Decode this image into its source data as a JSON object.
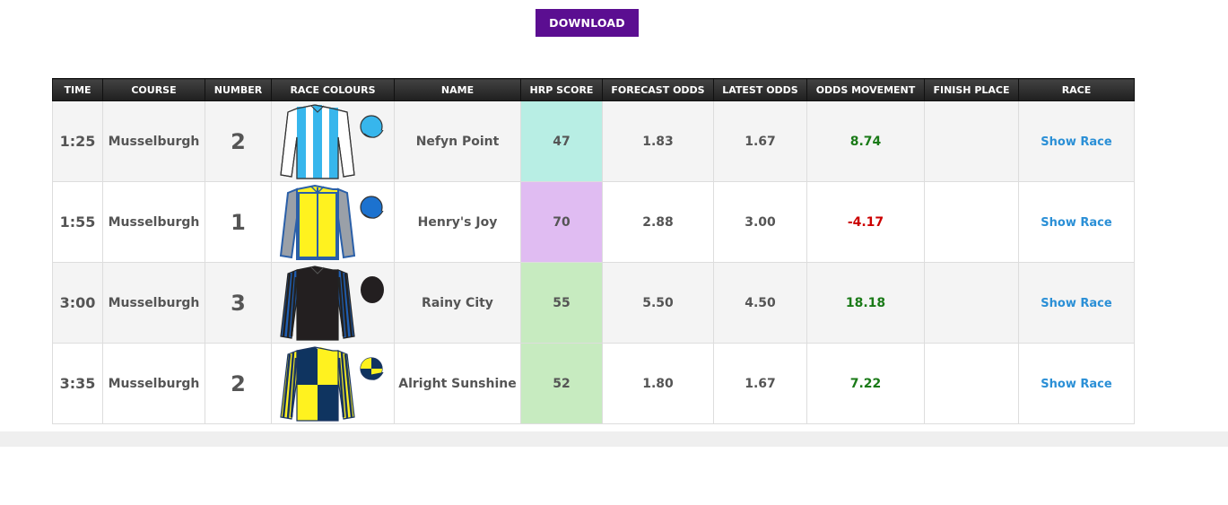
{
  "download_label": "DOWNLOAD",
  "headers": {
    "time": "TIME",
    "course": "COURSE",
    "number": "NUMBER",
    "colours": "RACE COLOURS",
    "name": "NAME",
    "hrp": "HRP SCORE",
    "forecast": "FORECAST ODDS",
    "latest": "LATEST ODDS",
    "movement": "ODDS MOVEMENT",
    "finish": "FINISH PLACE",
    "race": "RACE"
  },
  "rows": [
    {
      "time": "1:25",
      "course": "Musselburgh",
      "number": "2",
      "silks": "light-blue-white-stripes-silks",
      "name": "Nefyn Point",
      "hrp": "47",
      "hrp_color": "#b8eee4",
      "forecast": "1.83",
      "latest": "1.67",
      "movement": "8.74",
      "movement_color": "#1a7a17",
      "finish": "",
      "race": "Show Race"
    },
    {
      "time": "1:55",
      "course": "Musselburgh",
      "number": "1",
      "silks": "yellow-blue-sleeves-silks",
      "name": "Henry's Joy",
      "hrp": "70",
      "hrp_color": "#e0bcf2",
      "forecast": "2.88",
      "latest": "3.00",
      "movement": "-4.17",
      "movement_color": "#cc0000",
      "finish": "",
      "race": "Show Race"
    },
    {
      "time": "3:00",
      "course": "Musselburgh",
      "number": "3",
      "silks": "black-blue-striped-sleeves-silks",
      "name": "Rainy City",
      "hrp": "55",
      "hrp_color": "#c7ebc0",
      "forecast": "5.50",
      "latest": "4.50",
      "movement": "18.18",
      "movement_color": "#1a7a17",
      "finish": "",
      "race": "Show Race"
    },
    {
      "time": "3:35",
      "course": "Musselburgh",
      "number": "2",
      "silks": "navy-yellow-quartered-silks",
      "name": "Alright Sunshine",
      "hrp": "52",
      "hrp_color": "#c7ebc0",
      "forecast": "1.80",
      "latest": "1.67",
      "movement": "7.22",
      "movement_color": "#1a7a17",
      "finish": "",
      "race": "Show Race"
    }
  ]
}
